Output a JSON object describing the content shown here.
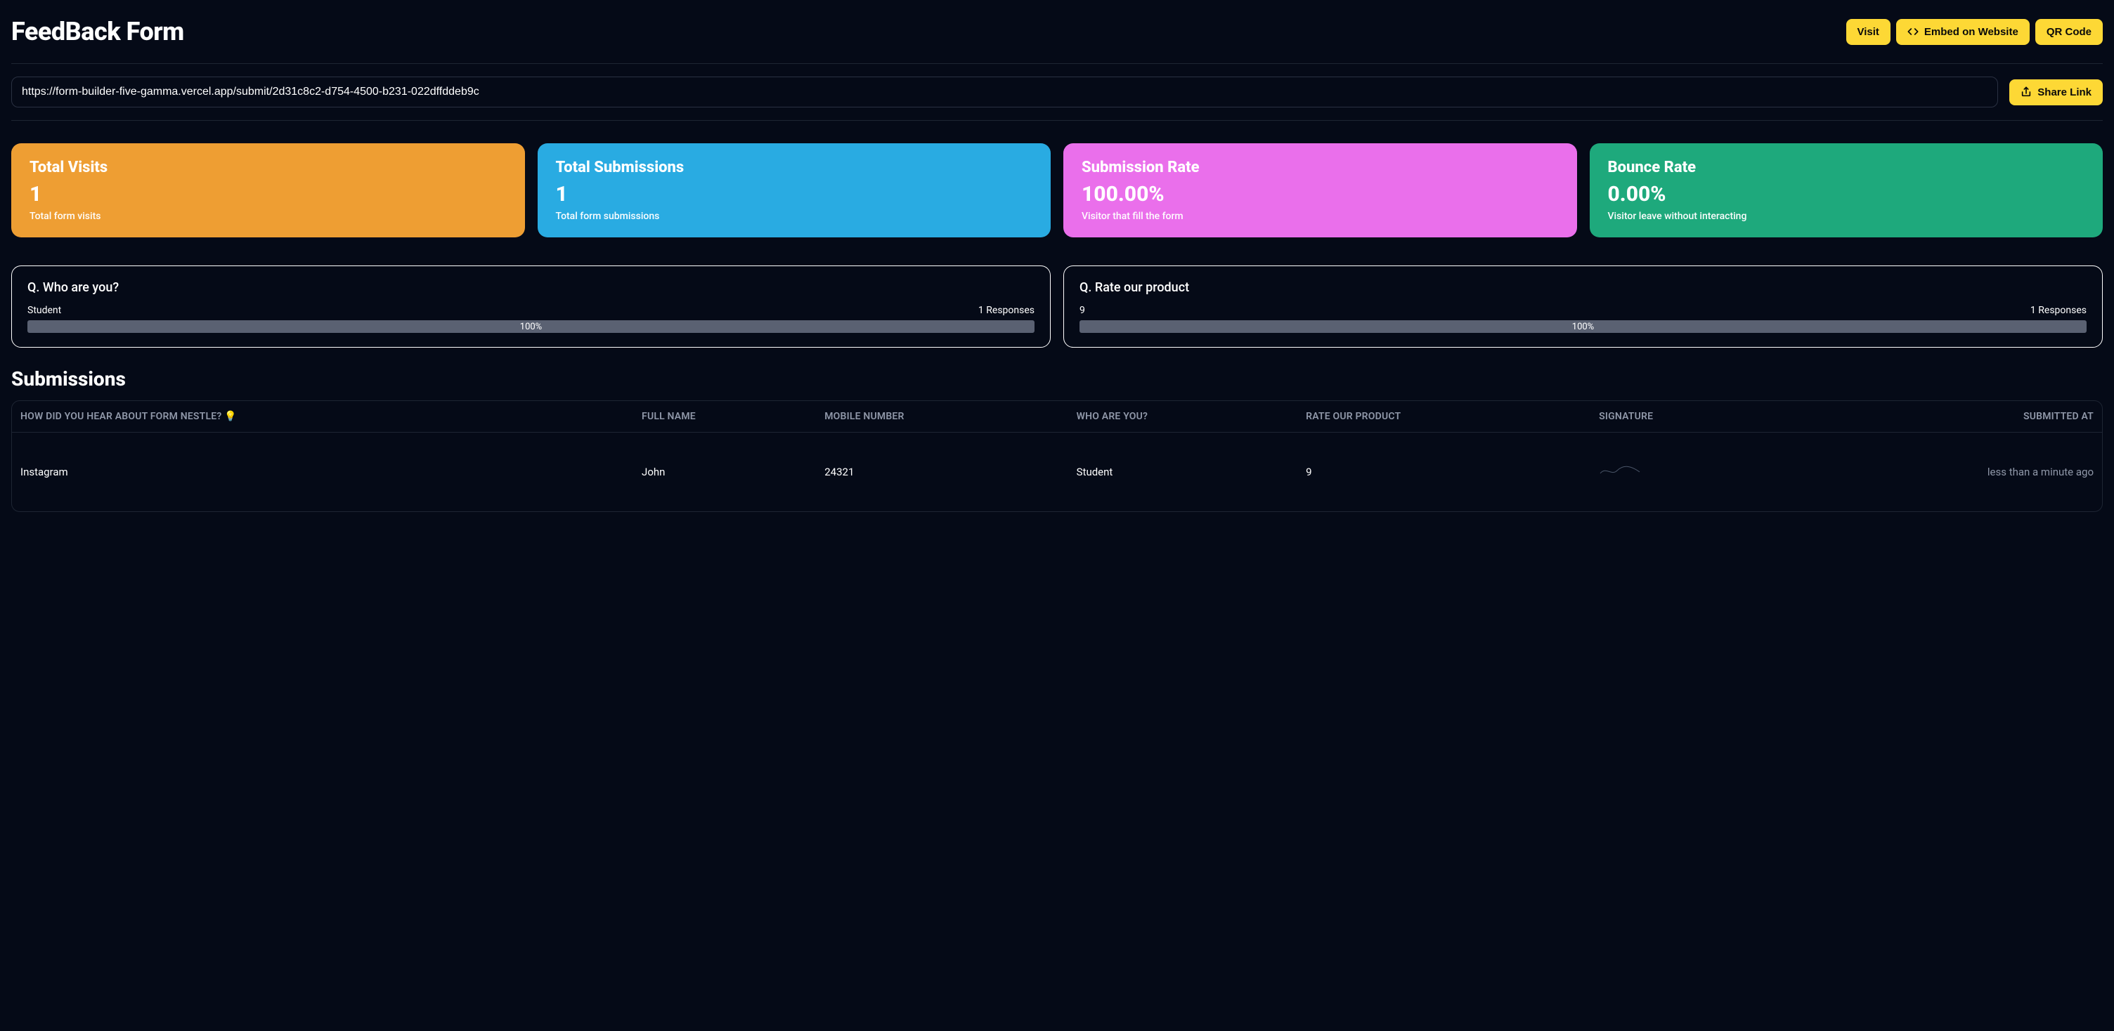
{
  "header": {
    "title": "FeedBack Form",
    "buttons": {
      "visit": "Visit",
      "embed": "Embed on Website",
      "qr": "QR Code"
    }
  },
  "share": {
    "url": "https://form-builder-five-gamma.vercel.app/submit/2d31c8c2-d754-4500-b231-022dffddeb9c",
    "button": "Share Link"
  },
  "stats": {
    "visits": {
      "title": "Total Visits",
      "value": "1",
      "desc": "Total form visits"
    },
    "submissions": {
      "title": "Total Submissions",
      "value": "1",
      "desc": "Total form submissions"
    },
    "rate": {
      "title": "Submission Rate",
      "value": "100.00%",
      "desc": "Visitor that fill the form"
    },
    "bounce": {
      "title": "Bounce Rate",
      "value": "0.00%",
      "desc": "Visitor leave without interacting"
    }
  },
  "questions": [
    {
      "title": "Q. Who are you?",
      "answer_label": "Student",
      "responses_label": "1 Responses",
      "percent_label": "100%"
    },
    {
      "title": "Q. Rate our product",
      "answer_label": "9",
      "responses_label": "1 Responses",
      "percent_label": "100%"
    }
  ],
  "submissions": {
    "heading": "Submissions",
    "columns": {
      "c0": "HOW DID YOU HEAR ABOUT FORM NESTLE? 💡",
      "c1": "FULL NAME",
      "c2": "MOBILE NUMBER",
      "c3": "WHO ARE YOU?",
      "c4": "RATE OUR PRODUCT",
      "c5": "SIGNATURE",
      "c6": "SUBMITTED AT"
    },
    "rows": [
      {
        "c0": "Instagram",
        "c1": "John",
        "c2": "24321",
        "c3": "Student",
        "c4": "9",
        "c5": "",
        "c6": "less than a minute ago"
      }
    ]
  }
}
